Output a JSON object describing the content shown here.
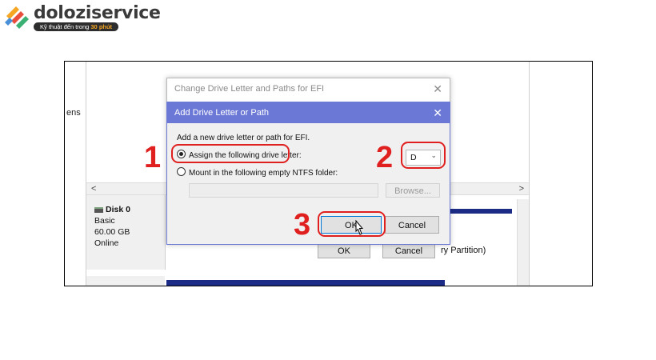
{
  "logo": {
    "name": "doloziservice",
    "tagline_prefix": "Kỹ thuật đến trong",
    "tagline_highlight": "30 phút"
  },
  "background": {
    "side_text": "ens",
    "disk": {
      "name": "Disk 0",
      "type": "Basic",
      "size": "60.00 GB",
      "status": "Online"
    },
    "partition_text": "ry Partition)",
    "ok_label": "OK",
    "cancel_label": "Cancel",
    "scroll_left": "<",
    "scroll_right": ">"
  },
  "outer_dialog": {
    "title": "Change Drive Letter and Paths for EFI",
    "close": "✕"
  },
  "inner_dialog": {
    "title": "Add Drive Letter or Path",
    "close": "✕",
    "description": "Add a new drive letter or path for EFI.",
    "option_assign": "Assign the following drive letter:",
    "option_mount": "Mount in the following empty NTFS folder:",
    "selected_option": "assign",
    "drive_letter": "D",
    "browse_label": "Browse...",
    "ok_label": "OK",
    "cancel_label": "Cancel"
  },
  "annotations": {
    "step1": "1",
    "step2": "2",
    "step3": "3",
    "color": "#e0201f"
  },
  "icons": {
    "logo": "logo-mark-icon",
    "disk": "disk-icon",
    "dropdown": "chevron-down-icon",
    "cursor": "mouse-pointer-icon"
  },
  "colors": {
    "inner_titlebar": "#6b78d6",
    "partition_bar": "#1c2c86"
  }
}
